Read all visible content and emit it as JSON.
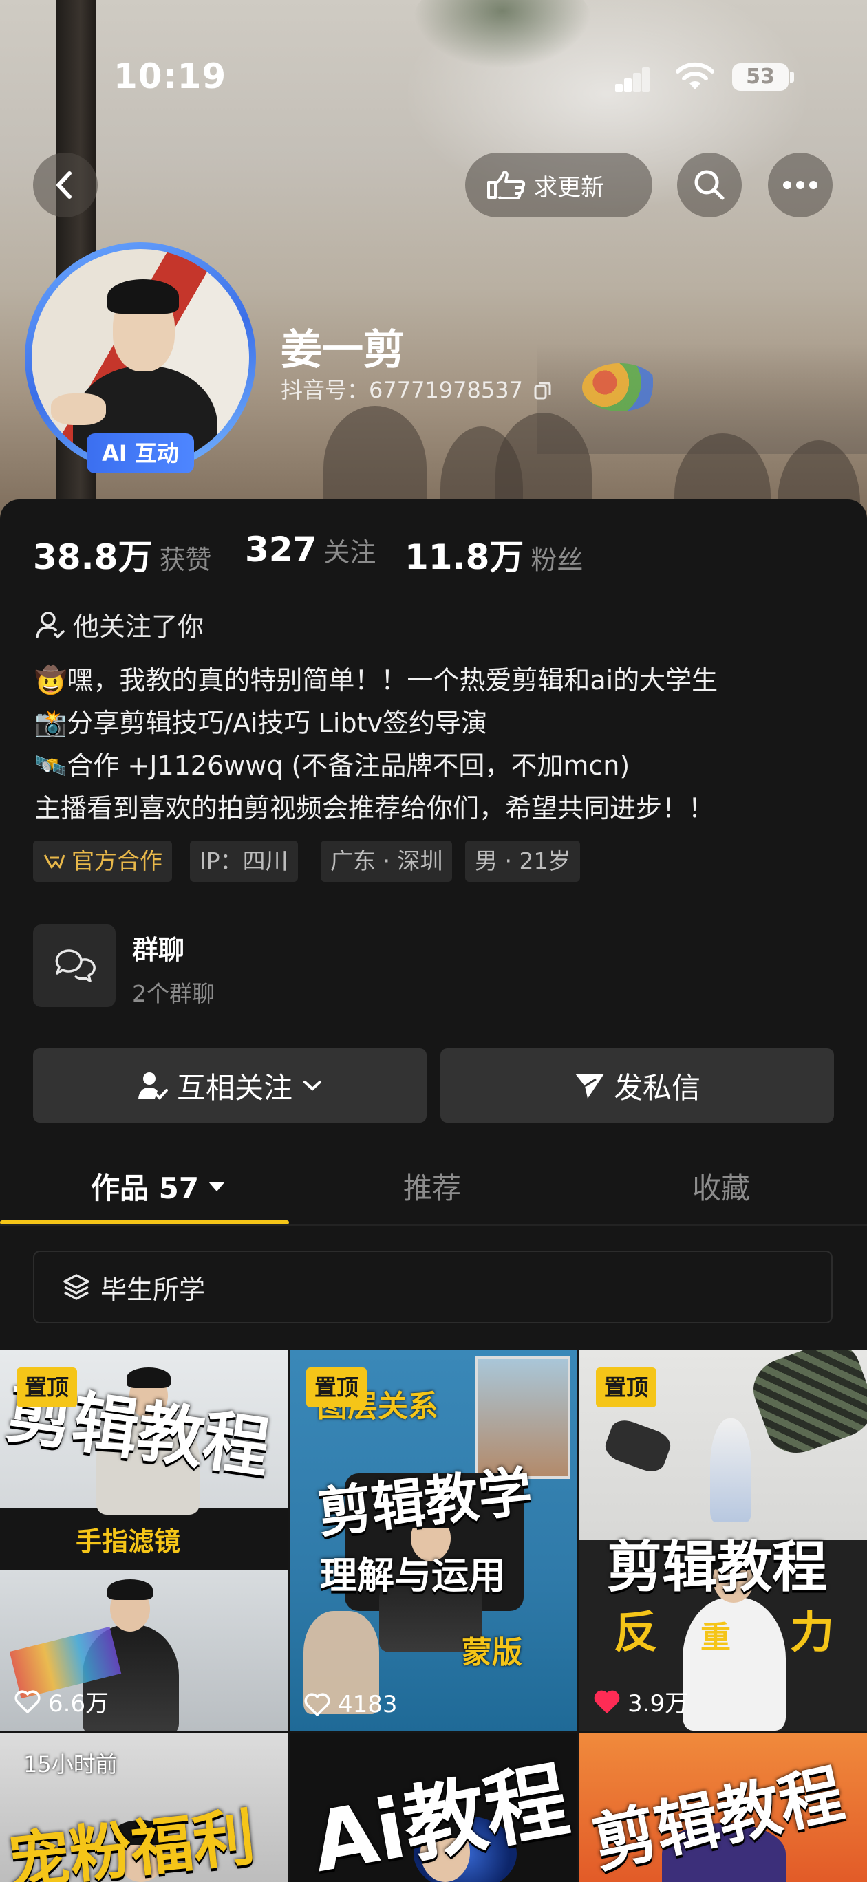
{
  "status_bar": {
    "time": "10:19",
    "battery": "53"
  },
  "header": {
    "request_update_label": "求更新",
    "icons": [
      "back-icon",
      "hand-point-icon",
      "search-icon",
      "more-icon"
    ]
  },
  "profile": {
    "name": "姜一剪",
    "douyin_id": "抖音号：67771978537",
    "ai_badge": "AI 互动"
  },
  "stats": [
    {
      "value": "38.8万",
      "label": "获赞"
    },
    {
      "value": "327",
      "label": "关注"
    },
    {
      "value": "11.8万",
      "label": "粉丝"
    }
  ],
  "follows_you": "他关注了你",
  "bio": [
    {
      "emoji": "🤠",
      "text": "嘿，我教的真的特别简单！！一个热爱剪辑和ai的大学生"
    },
    {
      "emoji": "📸",
      "text": "分享剪辑技巧/Ai技巧   Libtv签约导演"
    },
    {
      "emoji": "🛰️",
      "text": "合作 +J1126wwq (不备注品牌不回，不加mcn)"
    },
    {
      "emoji": "",
      "text": "主播看到喜欢的拍剪视频会推荐给你们，希望共同进步！！"
    }
  ],
  "tags": [
    "官方合作",
    "IP：四川",
    "广东 · 深圳",
    "男 · 21岁"
  ],
  "group_chat": {
    "title": "群聊",
    "subtitle": "2个群聊"
  },
  "actions": {
    "mutual_follow": "互相关注",
    "message": "发私信"
  },
  "tabs": [
    {
      "label": "作品 57",
      "active": true
    },
    {
      "label": "推荐",
      "active": false
    },
    {
      "label": "收藏",
      "active": false
    }
  ],
  "collection": "毕生所学",
  "videos": [
    {
      "badge": "置顶",
      "title_art": "剪辑教程",
      "caption_art": "手指滤镜",
      "likes": "6.6万",
      "liked": false
    },
    {
      "badge": "置顶",
      "title_art": "剪辑教学",
      "top_art": "图层关系",
      "caption_art": "理解与运用",
      "extra_art": "蒙版",
      "likes": "4183",
      "liked": false
    },
    {
      "badge": "置顶",
      "title_art": "剪辑教程",
      "caption_art": [
        "反",
        "重",
        "力"
      ],
      "likes": "3.9万",
      "liked": true
    },
    {
      "time_label": "15小时前",
      "title_art": "宠粉福利"
    },
    {
      "title_art": "Ai教程"
    },
    {
      "title_art": "剪辑教程"
    }
  ],
  "colors": {
    "accent": "#f5c518",
    "liked": "#fe2c55",
    "ai_badge": "#3b6ff0",
    "panel": "#161616"
  }
}
